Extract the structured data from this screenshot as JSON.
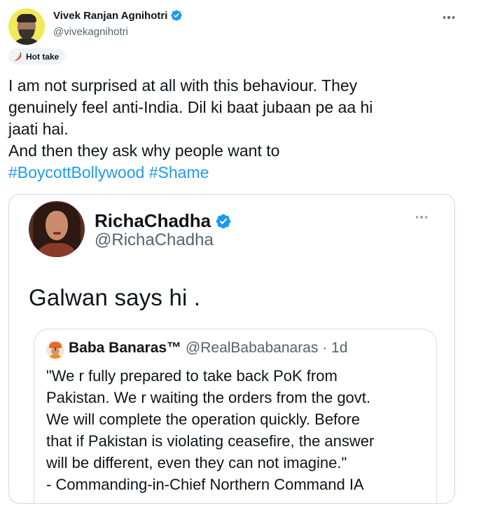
{
  "author": {
    "name": "Vivek Ranjan Agnihotri",
    "handle": "@vivekagnihotri",
    "verified_icon": "verified-badge-icon"
  },
  "badge": {
    "label": "Hot take",
    "icon": "chili-pepper-icon"
  },
  "tweet": {
    "line1": "I am not surprised at all with this behaviour. They",
    "line2": "genuinely feel anti-India. Dil ki baat jubaan pe aa hi",
    "line3": "jaati hai.",
    "line4": "And then they ask why people want to",
    "hashtag1": "#BoycottBollywood",
    "hashtag2": "#Shame"
  },
  "quoted": {
    "name": "RichaChadha",
    "handle": "@RichaChadha",
    "text": "Galwan says hi .",
    "inner": {
      "name": "Baba Banaras™",
      "handle_time": "@RealBababanaras · 1d",
      "line1": "\"We r fully prepared to take back PoK from",
      "line2": "Pakistan. We r waiting the orders from the govt.",
      "line3": "We will complete the operation quickly. Before",
      "line4": "that if Pakistan is violating ceasefire, the answer",
      "line5": "will be different, even they can not imagine.\"",
      "line6": "- Commanding-in-Chief Northern Command IA"
    }
  },
  "colors": {
    "link": "#1d9bf0",
    "verified": "#1d9bf0",
    "secondary_text": "#536471"
  }
}
